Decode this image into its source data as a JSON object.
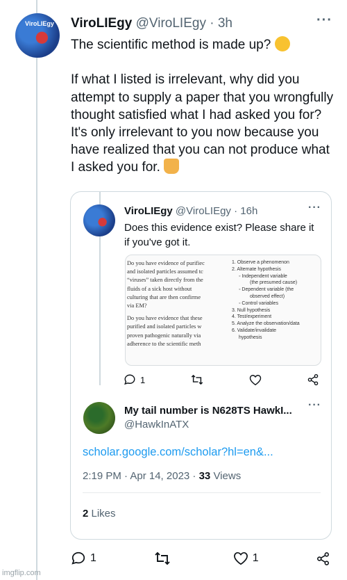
{
  "tweet": {
    "author_name": "ViroLIEgy",
    "author_handle": "@ViroLIEgy",
    "separator": "·",
    "time": "3h",
    "avatar_brand": "ViroLIEgy",
    "line1": "The scientific method is made up? ",
    "line2": "If what I listed is irrelevant, why did you attempt to supply a paper that you wrongfully thought satisfied what I had asked you for? It's only irrelevant to you now because you have realized that you can not produce what I asked you for. ",
    "emoji1_icon": "thinking-face-icon",
    "emoji2_icon": "farmer-icon",
    "replies": "1",
    "retweets": "",
    "likes": "1"
  },
  "quoted": {
    "author_name": "ViroLIEgy",
    "author_handle": "@ViroLIEgy",
    "separator": "·",
    "time": "16h",
    "text": "Does this evidence exist? Please share it if you've got it.",
    "replies": "1",
    "media": {
      "left_para1": [
        "Do you have evidence of purifiec",
        "and isolated particles assumed tc",
        "“viruses” taken directly from the",
        "fluids of a sick host without",
        "culturing that are then confirme",
        "via EM?"
      ],
      "left_para2": [
        "Do you have evidence that these",
        "purified and isolated particles w",
        "proven pathogenic naturally via",
        "adherence to the scientific meth"
      ],
      "steps": [
        {
          "text": "1. Observe a phenomenon",
          "cls": ""
        },
        {
          "text": "2. Alternate hypothesis",
          "cls": ""
        },
        {
          "text": "◦ Independent variable",
          "cls": "sub"
        },
        {
          "text": "(the presumed cause)",
          "cls": "subsub"
        },
        {
          "text": "◦ Dependent variable (the",
          "cls": "sub"
        },
        {
          "text": "observed effect)",
          "cls": "subsub"
        },
        {
          "text": "◦ Control variables",
          "cls": "sub"
        },
        {
          "text": "3. Null hypothesis",
          "cls": ""
        },
        {
          "text": "4. Test/experiment",
          "cls": ""
        },
        {
          "text": "5. Analyze the observation/data",
          "cls": ""
        },
        {
          "text": "6. Validate/invalidate",
          "cls": ""
        },
        {
          "text": "hypothesis",
          "cls": "sub"
        }
      ]
    }
  },
  "reply": {
    "author_name": "My tail number is N628TS HawkI...",
    "author_handle": "@HawkInATX",
    "link": "scholar.google.com/scholar?hl=en&...",
    "meta_prefix": "2:19 PM · Apr 14, 2023 · ",
    "views_count": "33",
    "views_label": " Views",
    "likes_count": "2",
    "likes_label": " Likes"
  },
  "watermark": "imgflip.com",
  "colors": {
    "text": "#0f1419",
    "muted": "#536471",
    "link": "#1d9bf0",
    "border": "#cfd9de"
  }
}
